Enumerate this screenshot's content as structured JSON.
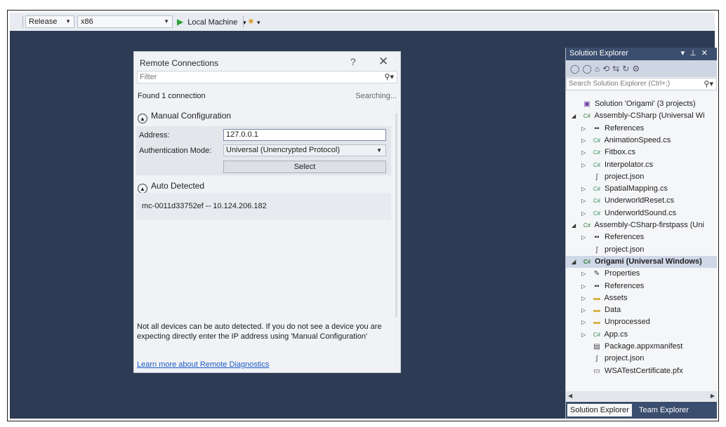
{
  "toolbar": {
    "config": "Release",
    "platform": "x86",
    "run_label": "Local Machine",
    "run_dropdown": "▾"
  },
  "dialog": {
    "title": "Remote Connections",
    "help": "?",
    "close": "✕",
    "filter_placeholder": "Filter",
    "found": "Found 1 connection",
    "searching": "Searching...",
    "manual_header": "Manual Configuration",
    "address_label": "Address:",
    "address_value": "127.0.0.1",
    "auth_label": "Authentication Mode:",
    "auth_value": "Universal (Unencrypted Protocol)",
    "select_button": "Select",
    "auto_header": "Auto Detected",
    "device": "mc-0011d33752ef -- 10.124.206.182",
    "note": "Not all devices can be auto detected. If you do not see a device you are expecting directly enter the IP address using 'Manual Configuration'",
    "learn_link": "Learn more about Remote Diagnostics"
  },
  "solution_explorer": {
    "title": "Solution Explorer",
    "search_placeholder": "Search Solution Explorer (Ctrl+;)",
    "tree": [
      {
        "label": "Solution 'Origami' (3 projects)",
        "icon": "solution-icon",
        "level": 0,
        "toggle": ""
      },
      {
        "label": "Assembly-CSharp (Universal Wi",
        "icon": "csproj-icon",
        "level": 0,
        "toggle": "expanded"
      },
      {
        "label": "References",
        "icon": "references-icon",
        "level": 1,
        "toggle": "collapsed"
      },
      {
        "label": "AnimationSpeed.cs",
        "icon": "cs-file-icon",
        "level": 1,
        "toggle": "collapsed"
      },
      {
        "label": "Fitbox.cs",
        "icon": "cs-file-icon",
        "level": 1,
        "toggle": "collapsed"
      },
      {
        "label": "Interpolator.cs",
        "icon": "cs-file-icon",
        "level": 1,
        "toggle": "collapsed"
      },
      {
        "label": "project.json",
        "icon": "json-file-icon",
        "level": 1,
        "toggle": ""
      },
      {
        "label": "SpatialMapping.cs",
        "icon": "cs-file-icon",
        "level": 1,
        "toggle": "collapsed"
      },
      {
        "label": "UnderworldReset.cs",
        "icon": "cs-file-icon",
        "level": 1,
        "toggle": "collapsed"
      },
      {
        "label": "UnderworldSound.cs",
        "icon": "cs-file-icon",
        "level": 1,
        "toggle": "collapsed"
      },
      {
        "label": "Assembly-CSharp-firstpass (Uni",
        "icon": "csproj-icon",
        "level": 0,
        "toggle": "expanded"
      },
      {
        "label": "References",
        "icon": "references-icon",
        "level": 1,
        "toggle": "collapsed"
      },
      {
        "label": "project.json",
        "icon": "json-file-icon",
        "level": 1,
        "toggle": ""
      },
      {
        "label": "Origami (Universal Windows)",
        "icon": "csproj-icon",
        "level": 0,
        "toggle": "expanded",
        "selected": true
      },
      {
        "label": "Properties",
        "icon": "wrench-icon",
        "level": 1,
        "toggle": "collapsed"
      },
      {
        "label": "References",
        "icon": "references-icon",
        "level": 1,
        "toggle": "collapsed"
      },
      {
        "label": "Assets",
        "icon": "folder-icon",
        "level": 1,
        "toggle": "collapsed"
      },
      {
        "label": "Data",
        "icon": "folder-icon",
        "level": 1,
        "toggle": "collapsed"
      },
      {
        "label": "Unprocessed",
        "icon": "folder-icon",
        "level": 1,
        "toggle": "collapsed"
      },
      {
        "label": "App.cs",
        "icon": "cs-file-icon",
        "level": 1,
        "toggle": "collapsed"
      },
      {
        "label": "Package.appxmanifest",
        "icon": "manifest-icon",
        "level": 1,
        "toggle": ""
      },
      {
        "label": "project.json",
        "icon": "json-file-icon",
        "level": 1,
        "toggle": ""
      },
      {
        "label": "WSATestCertificate.pfx",
        "icon": "certificate-icon",
        "level": 1,
        "toggle": ""
      }
    ],
    "tabs": [
      "Solution Explorer",
      "Team Explorer"
    ]
  },
  "colors": {
    "ide_background": "#2d3b55",
    "panel_title": "#3b4e6e",
    "run_green": "#2e9e3a",
    "link": "#1e5bc6"
  }
}
